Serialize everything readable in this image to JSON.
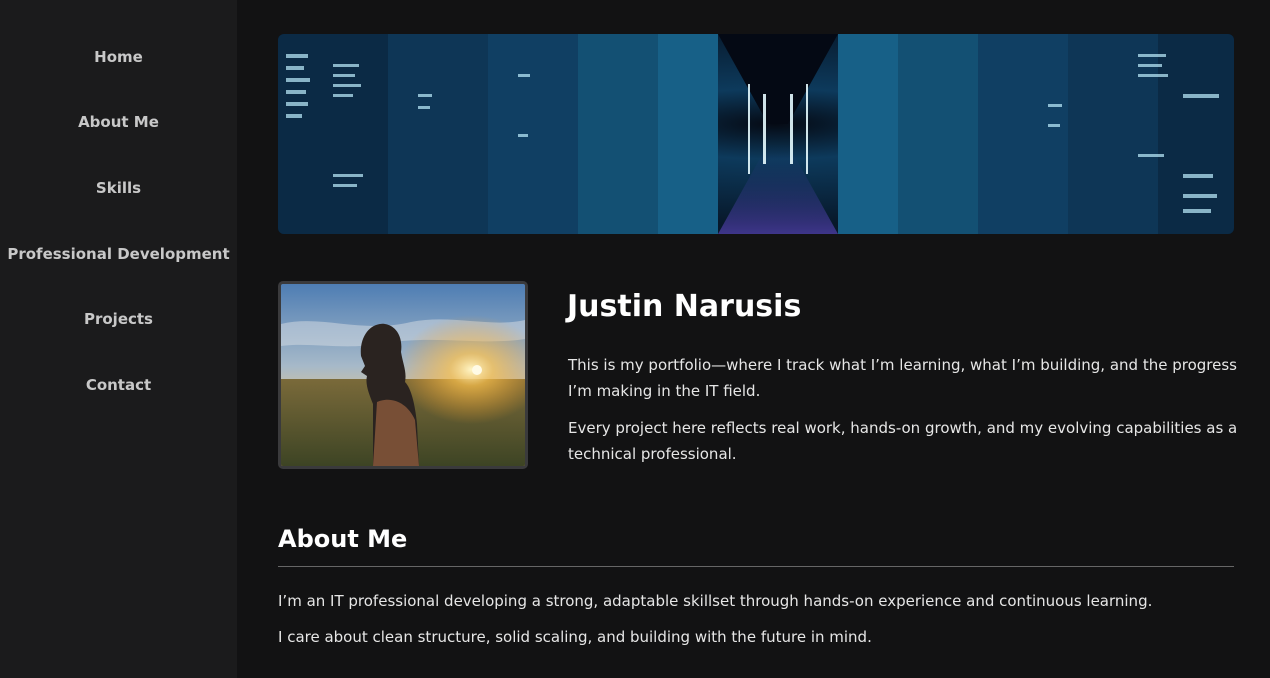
{
  "nav": {
    "items": [
      {
        "label": "Home"
      },
      {
        "label": "About Me"
      },
      {
        "label": "Skills"
      },
      {
        "label": "Professional Development"
      },
      {
        "label": "Projects"
      },
      {
        "label": "Contact"
      }
    ]
  },
  "banner": {
    "description_icon": "digital-data-corridor-image"
  },
  "profile": {
    "name": "Justin Narusis",
    "intro": [
      "This is my portfolio—where I track what I’m learning, what I’m building, and the progress I’m making in the IT field.",
      "Every project here reflects real work, hands-on growth, and my evolving capabilities as a technical professional."
    ],
    "photo_icon": "profile-photo"
  },
  "about": {
    "title": "About Me",
    "paragraphs": [
      "I’m an IT professional developing a strong, adaptable skillset through hands-on experience and continuous learning.",
      "I care about clean structure, solid scaling, and building with the future in mind."
    ]
  },
  "colors": {
    "background": "#121213",
    "sidebar": "#1b1b1c",
    "accent_cyan": "#4fc3f7"
  }
}
